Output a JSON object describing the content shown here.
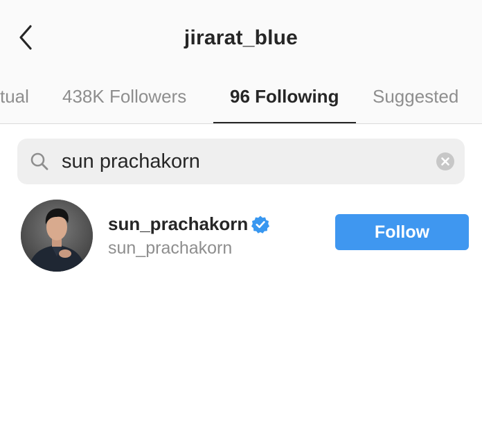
{
  "header": {
    "title": "jirarat_blue",
    "back_icon": "chevron-left-icon"
  },
  "tabs": [
    {
      "label": "tual",
      "active": false
    },
    {
      "label": "438K Followers",
      "active": false
    },
    {
      "label": "96 Following",
      "active": true
    },
    {
      "label": "Suggested",
      "active": false
    }
  ],
  "search": {
    "value": "sun prachakorn",
    "icon": "search-icon",
    "clear_icon": "clear-icon"
  },
  "results": [
    {
      "username": "sun_prachakorn",
      "subtitle": "sun_prachakorn",
      "verified": true,
      "follow_label": "Follow"
    }
  ],
  "colors": {
    "follow_button": "#3f97f0",
    "verified_badge": "#3897f0",
    "primary_text": "#262626",
    "secondary_text": "#8e8e8e",
    "header_background": "#fafafa",
    "search_background": "#efefef"
  }
}
